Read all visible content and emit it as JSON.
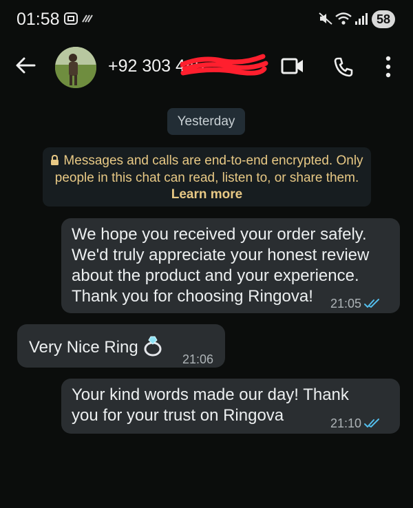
{
  "status_bar": {
    "time": "01:58",
    "battery": "58"
  },
  "header": {
    "contact_number": "+92 303 445",
    "icons": [
      "back-arrow-icon",
      "video-call-icon",
      "phone-icon",
      "more-options-icon"
    ]
  },
  "chat": {
    "date_label": "Yesterday",
    "encryption_notice": {
      "text": "Messages and calls are end-to-end encrypted. Only people in this chat can read, listen to, or share them.",
      "link": "Learn more"
    },
    "messages": [
      {
        "direction": "outgoing",
        "text": "We hope you received your order safely.\nWe'd truly appreciate your honest review\nabout the product and your experience.\nThank you for choosing Ringova!",
        "time": "21:05",
        "status": "read"
      },
      {
        "direction": "incoming",
        "text": "Very Nice Ring",
        "emoji": "ring-emoji",
        "time": "21:06"
      },
      {
        "direction": "outgoing",
        "text": "Your kind words made our day! Thank\nyou for your trust on Ringova",
        "time": "21:10",
        "status": "read"
      }
    ]
  },
  "colors": {
    "background": "#0b0d0c",
    "bubble": "#2a2e31",
    "notice_text": "#e8c985",
    "read_tick": "#53bdeb"
  }
}
